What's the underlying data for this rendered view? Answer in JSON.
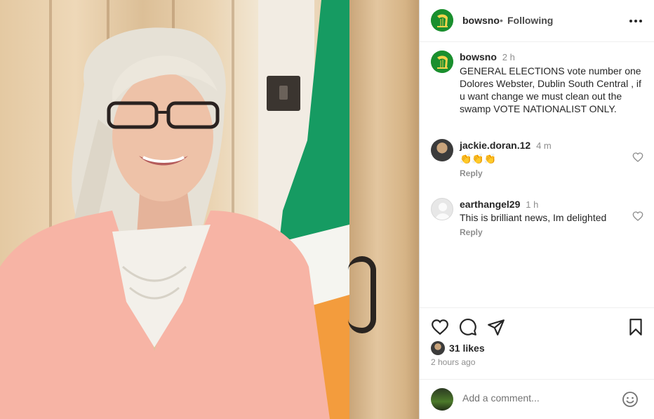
{
  "post": {
    "username": "bowsno",
    "follow_status": "Following",
    "dot": "•",
    "caption": {
      "username": "bowsno",
      "time": "2 h",
      "text": "GENERAL ELECTIONS vote number one Dolores Webster, Dublin South Central , if u want change we must clean out the swamp VOTE NATIONALIST ONLY."
    },
    "comments": [
      {
        "username": "jackie.doran.12",
        "time": "4 m",
        "text": "👏👏👏",
        "reply_label": "Reply"
      },
      {
        "username": "earthangel29",
        "time": "1 h",
        "text": "This is brilliant news, Im delighted",
        "reply_label": "Reply"
      }
    ],
    "likes": "31 likes",
    "posted_ago": "2 hours ago",
    "add_comment_placeholder": "Add a comment..."
  },
  "icons": {
    "more": "more-horizontal-icon",
    "like": "heart-icon",
    "comment": "comment-icon",
    "share": "send-icon",
    "save": "bookmark-icon",
    "emoji": "smiley-icon"
  },
  "colors": {
    "brand_avatar": "#1a8f2e",
    "flag_green": "#169b62",
    "flag_white": "#f5f5f0",
    "flag_orange": "#f39c3d",
    "shirt": "#f7b4a5"
  }
}
